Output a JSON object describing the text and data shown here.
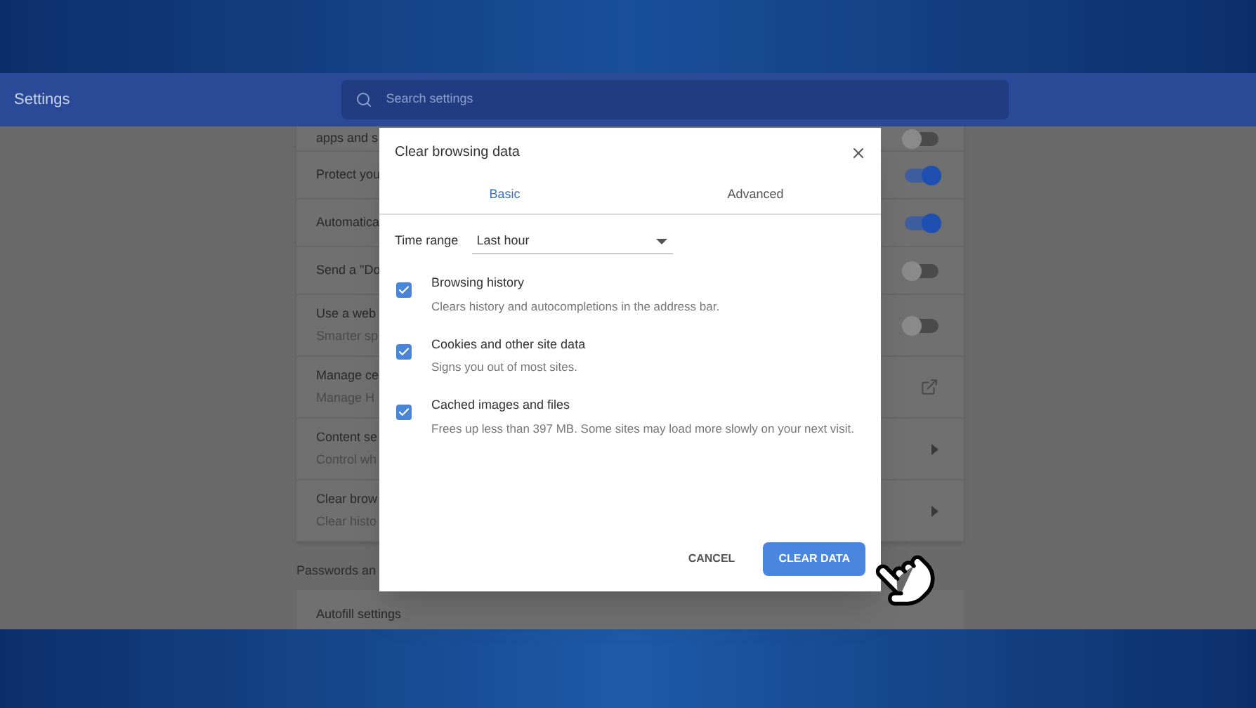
{
  "header": {
    "title": "Settings",
    "search": {
      "placeholder": "Search settings"
    }
  },
  "settings_rows": [
    {
      "kind": "toggle",
      "title": "apps and s",
      "on": false
    },
    {
      "kind": "toggle",
      "title": "Protect you",
      "on": true
    },
    {
      "kind": "toggle",
      "title": "Automatica",
      "on": true
    },
    {
      "kind": "toggle",
      "title": "Send a \"Do",
      "on": false
    },
    {
      "kind": "toggle",
      "title": "Use a web",
      "subtitle": "Smarter sp",
      "on": false
    },
    {
      "kind": "external",
      "title": "Manage ce",
      "subtitle": "Manage H"
    },
    {
      "kind": "arrow",
      "title": "Content se",
      "subtitle": "Control wh"
    },
    {
      "kind": "arrow",
      "title": "Clear brow",
      "subtitle": "Clear histo"
    }
  ],
  "section_heading": "Passwords an",
  "autofill_row": {
    "title": "Autofill settings"
  },
  "dialog": {
    "title": "Clear browsing data",
    "tabs": [
      {
        "label": "Basic",
        "selected": true
      },
      {
        "label": "Advanced",
        "selected": false
      }
    ],
    "time_range": {
      "label": "Time range",
      "value": "Last hour"
    },
    "options": [
      {
        "title": "Browsing history",
        "description": "Clears history and autocompletions in the address bar.",
        "checked": true
      },
      {
        "title": "Cookies and other site data",
        "description": "Signs you out of most sites.",
        "checked": true
      },
      {
        "title": "Cached images and files",
        "description": "Frees up less than 397 MB. Some sites may load more slowly on your next visit.",
        "checked": true
      }
    ],
    "buttons": [
      {
        "kind": "text",
        "label": "CANCEL"
      },
      {
        "kind": "primary",
        "label": "CLEAR DATA"
      }
    ]
  }
}
